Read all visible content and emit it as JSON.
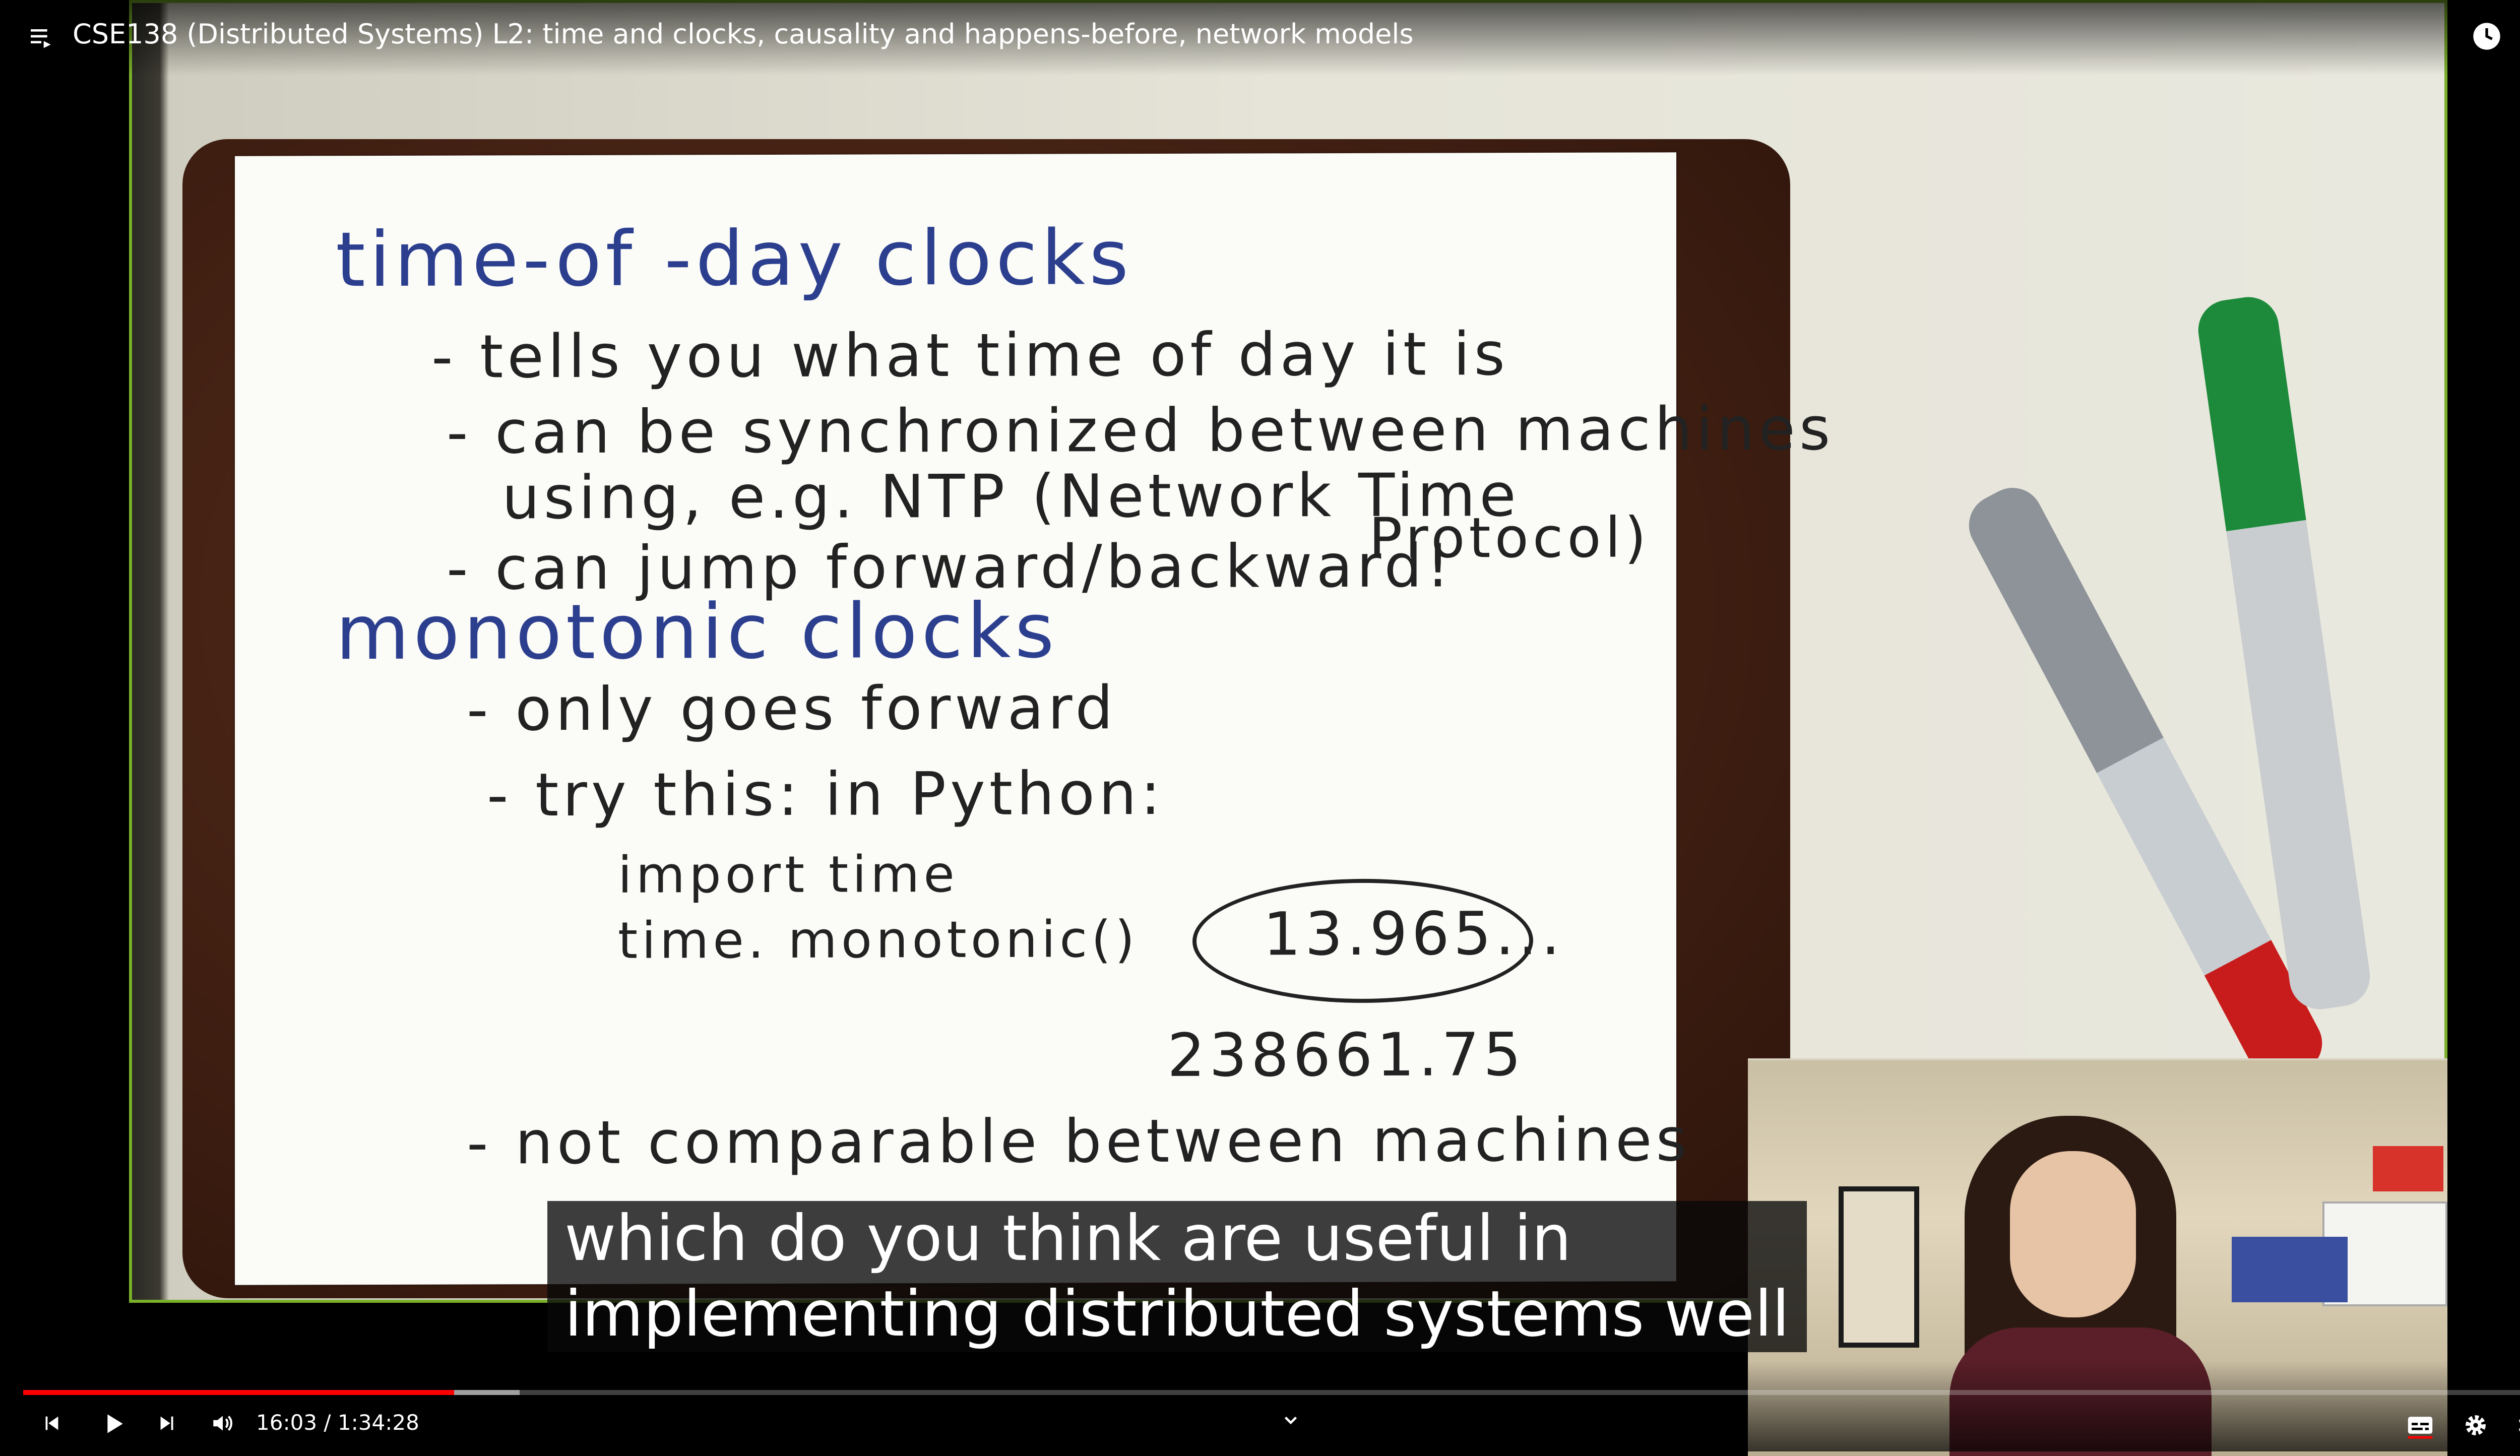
{
  "window": {
    "title": "CSE138 (Distributed Systems) L2: time and clocks, causality and happens-before, network models"
  },
  "slide": {
    "h1": "time-of -day clocks",
    "l1": "- tells you what time of day it is",
    "l2": "- can be synchronized between machines",
    "l3": "using, e.g. NTP (Network Time",
    "l3b": "Protocol)",
    "l4": "- can jump forward/backward!",
    "h2": "monotonic clocks",
    "l5": "- only goes forward",
    "l6": "- try this: in Python:",
    "l7": "import time",
    "l8": "time. monotonic()",
    "oval_value": "13.965...",
    "l9": "238661.75",
    "l10": "- not comparable between machines"
  },
  "caption": {
    "line1": "which do you think are useful in",
    "line2": "implementing distributed systems well"
  },
  "player": {
    "time_display": "16:03 / 1:34:28",
    "progress_played_fraction": 0.17,
    "progress_buffered_fraction": 0.196,
    "accent": "#ff0000",
    "frame_accent": "#7ab02a"
  },
  "icons": {
    "playlist": "playlist-icon",
    "watch_later": "clock-icon",
    "share": "share-icon",
    "previous": "skip-previous-icon",
    "play": "play-icon",
    "next": "skip-next-icon",
    "volume": "volume-icon",
    "chevron": "chevron-down-icon",
    "captions": "captions-icon",
    "settings": "gear-icon",
    "fullscreen_exit": "exit-fullscreen-icon"
  }
}
